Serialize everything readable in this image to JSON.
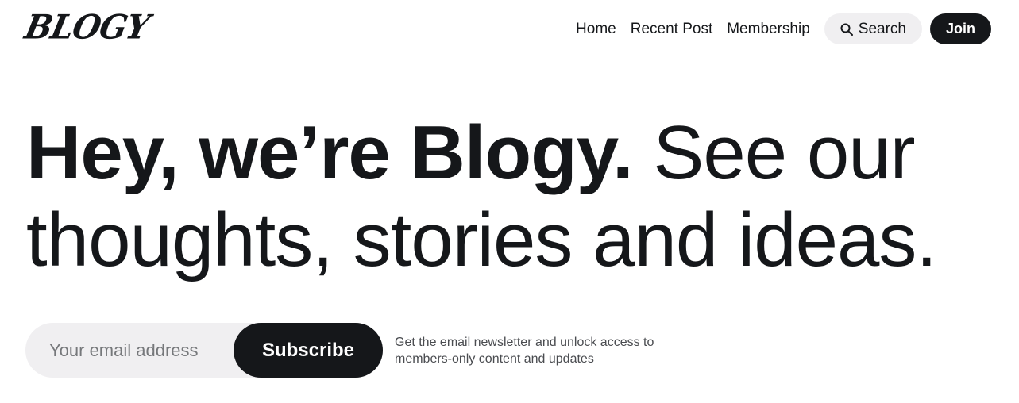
{
  "header": {
    "logo": "BLOGY",
    "nav": [
      "Home",
      "Recent Post",
      "Membership"
    ],
    "search_label": "Search",
    "join_label": "Join"
  },
  "hero": {
    "bold": "Hey, we’re Blogy.",
    "light_1": " See our",
    "light_2": "thoughts, stories and ideas."
  },
  "subscribe": {
    "placeholder": "Your email address",
    "button_label": "Subscribe",
    "note": "Get the email newsletter and unlock access to members-only content and updates"
  },
  "colors": {
    "text": "#15171a",
    "pill_background": "#f0eff1",
    "button_background": "#15171a"
  }
}
